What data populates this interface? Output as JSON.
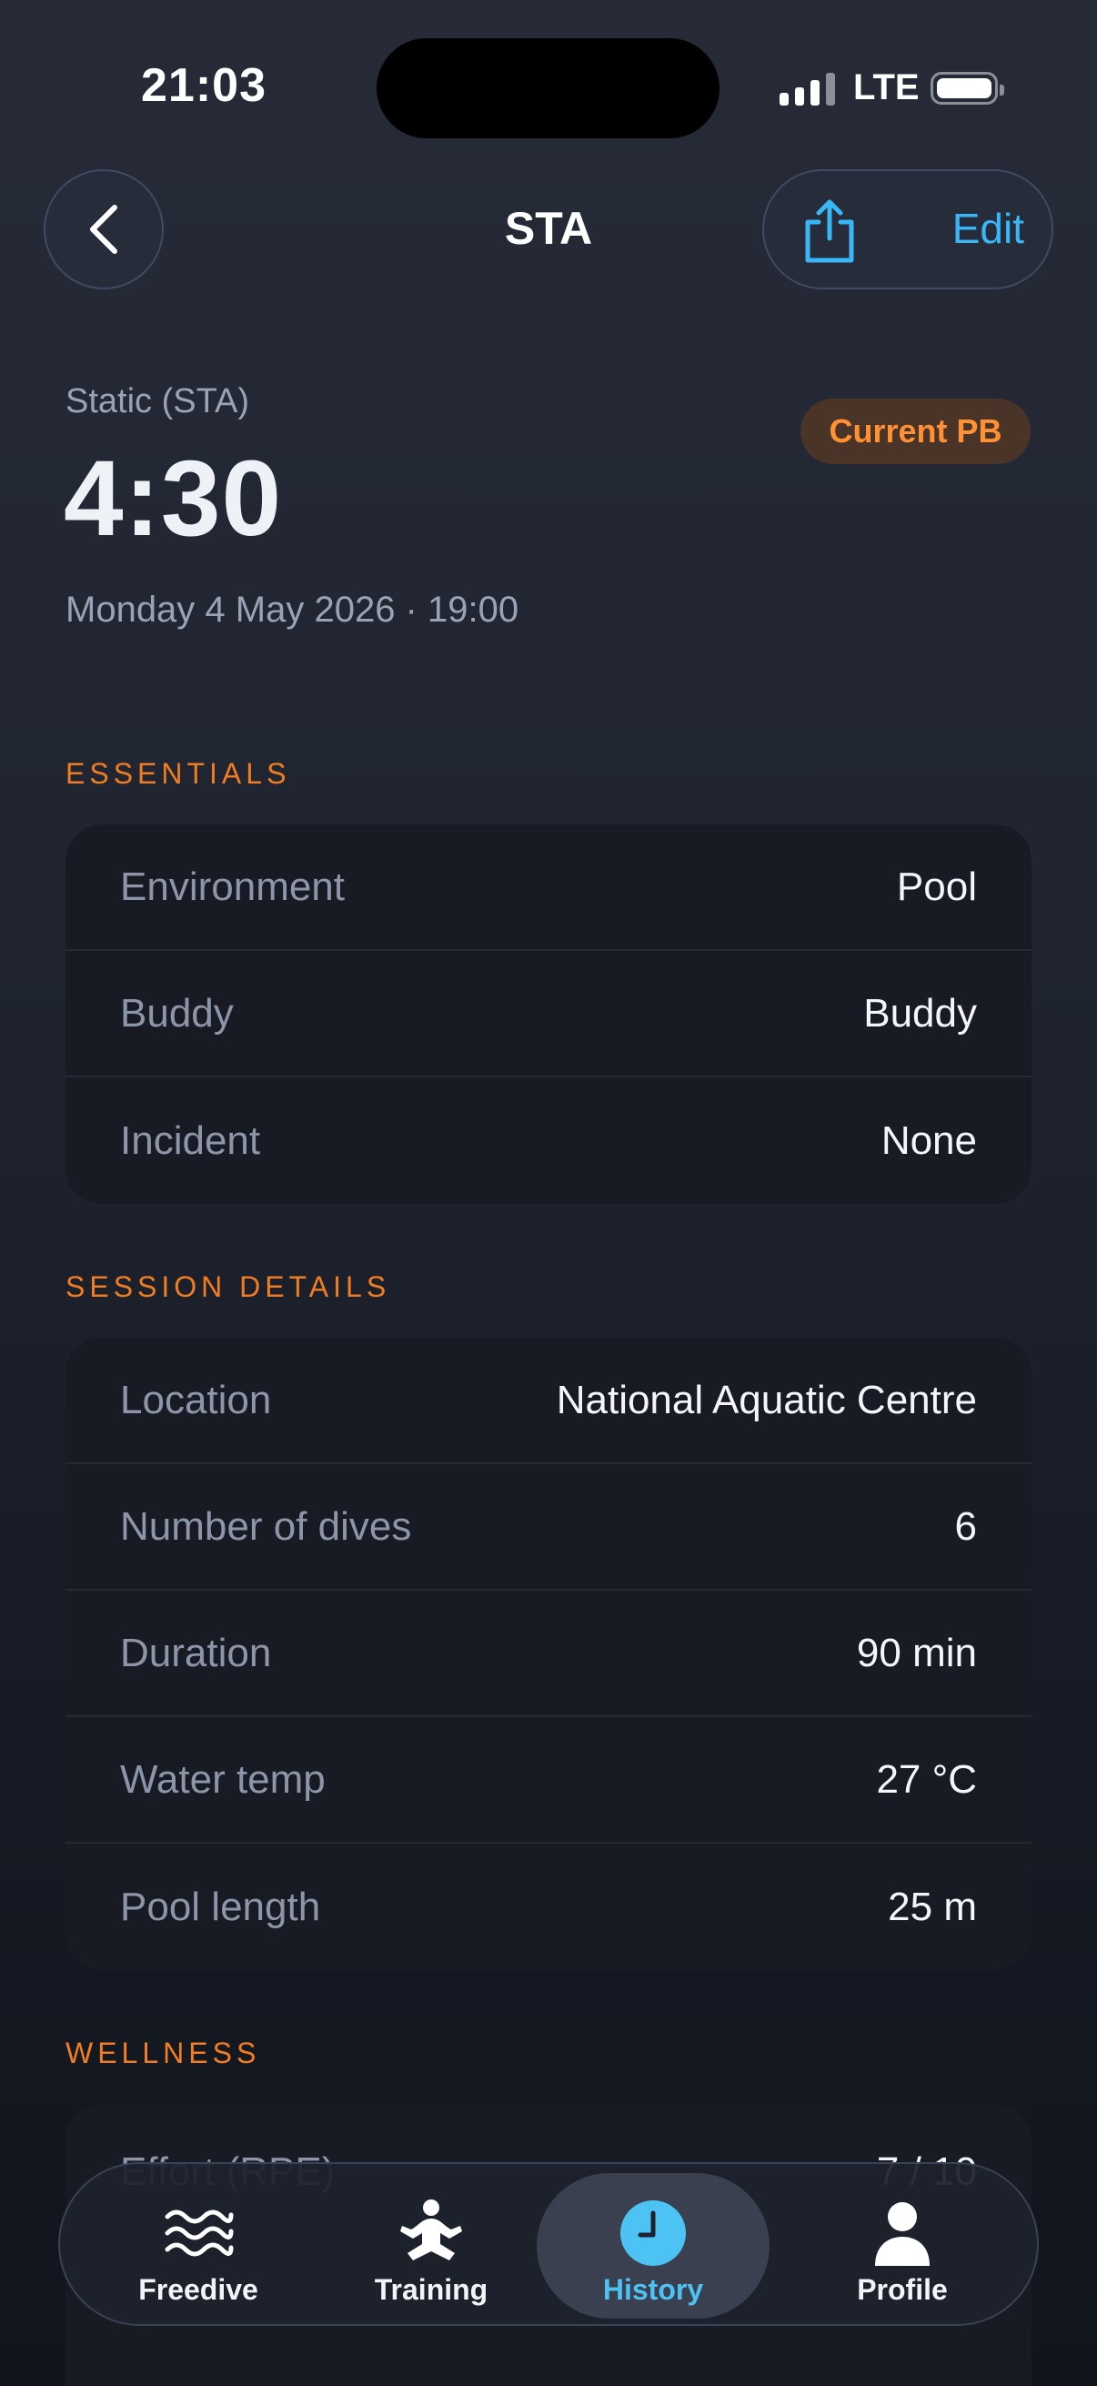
{
  "status": {
    "time": "21:03",
    "network": "LTE"
  },
  "nav": {
    "title": "STA",
    "edit_label": "Edit"
  },
  "header": {
    "activity": "Static (STA)",
    "result": "4:30",
    "badge": "Current PB",
    "date": "Monday 4 May 2026 · 19:00"
  },
  "essentials": {
    "title": "ESSENTIALS",
    "rows": [
      {
        "label": "Environment",
        "value": "Pool"
      },
      {
        "label": "Buddy",
        "value": "Buddy"
      },
      {
        "label": "Incident",
        "value": "None"
      }
    ]
  },
  "session": {
    "title": "SESSION DETAILS",
    "rows": [
      {
        "label": "Location",
        "value": "National Aquatic Centre"
      },
      {
        "label": "Number of dives",
        "value": "6"
      },
      {
        "label": "Duration",
        "value": "90 min"
      },
      {
        "label": "Water temp",
        "value": "27 °C"
      },
      {
        "label": "Pool length",
        "value": "25 m"
      }
    ]
  },
  "wellness": {
    "title": "WELLNESS",
    "rows": [
      {
        "label": "Effort (RPE)",
        "value": "7 / 10"
      }
    ]
  },
  "tabs": [
    {
      "label": "Freedive",
      "icon": "waves-icon"
    },
    {
      "label": "Training",
      "icon": "meditation-icon"
    },
    {
      "label": "History",
      "icon": "clock-icon"
    },
    {
      "label": "Profile",
      "icon": "person-icon"
    }
  ],
  "colors": {
    "accent": "#38b6f5",
    "section": "#f07d22",
    "badge_text": "#ff9033",
    "active_tab": "#4cc3f3"
  }
}
